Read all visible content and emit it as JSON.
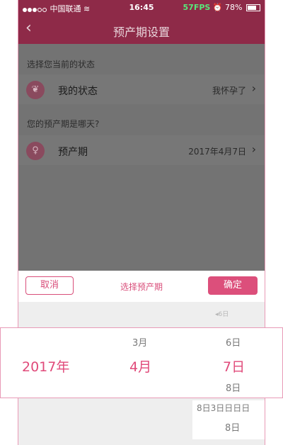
{
  "status_bar": {
    "carrier": "中国联通",
    "time": "16:45",
    "fps": "57FPS",
    "battery": "78%"
  },
  "nav": {
    "back_icon": "chevron-left",
    "title": "预产期设置"
  },
  "sections": [
    {
      "label": "选择您当前的状态",
      "row_label": "我的状态",
      "row_value": "我怀孕了",
      "icon": "sprout-icon"
    },
    {
      "label": "您的预产期是哪天?",
      "row_label": "预产期",
      "row_value": "2017年4月7日",
      "icon": "pregnant-icon"
    }
  ],
  "picker": {
    "cancel": "取消",
    "title": "选择预产期",
    "confirm": "确定",
    "year": "2017年",
    "month_prev": "3月",
    "month": "4月",
    "day_prev": "6日",
    "day": "7日",
    "day_next": "8日",
    "overlap_text": "8日3日日日日",
    "lower_day": "8日"
  },
  "colors": {
    "accent": "#dc4f7b",
    "nav_bg": "#8e2a48"
  }
}
